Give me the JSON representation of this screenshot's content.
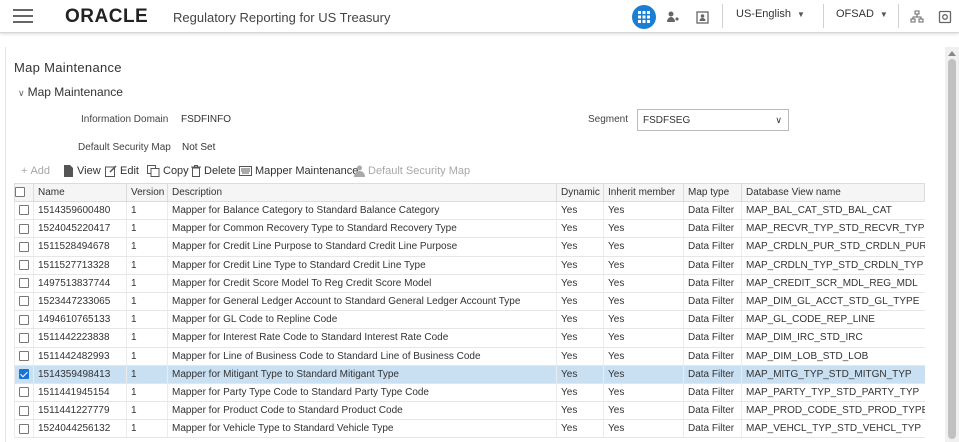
{
  "header": {
    "logo": "ORACLE",
    "app_title": "Regulatory Reporting for US Treasury",
    "language": "US-English",
    "user": "OFSAD",
    "accent_color": "#1a7fd4"
  },
  "page": {
    "title": "Map Maintenance",
    "section_title": "Map Maintenance",
    "info_domain_label": "Information Domain",
    "info_domain_value": "FSDFINFO",
    "segment_label": "Segment",
    "segment_value": "FSDFSEG",
    "default_security_map_label": "Default Security Map",
    "default_security_map_value": "Not Set"
  },
  "toolbar": {
    "add": "Add",
    "view": "View",
    "edit": "Edit",
    "copy": "Copy",
    "delete": "Delete",
    "mapper_maintenance": "Mapper Maintenance",
    "default_security_map": "Default Security Map"
  },
  "table": {
    "columns": [
      "Name",
      "Version",
      "Description",
      "Dynamic",
      "Inherit member",
      "Map type",
      "Database View name"
    ],
    "rows": [
      {
        "name": "1514359600480",
        "version": "1",
        "description": "Mapper for Balance Category to Standard Balance Category",
        "dynamic": "Yes",
        "inherit": "Yes",
        "map_type": "Data Filter",
        "view": "MAP_BAL_CAT_STD_BAL_CAT",
        "checked": false
      },
      {
        "name": "1524045220417",
        "version": "1",
        "description": "Mapper for Common Recovery Type to Standard Recovery Type",
        "dynamic": "Yes",
        "inherit": "Yes",
        "map_type": "Data Filter",
        "view": "MAP_RECVR_TYP_STD_RECVR_TYP",
        "checked": false
      },
      {
        "name": "1511528494678",
        "version": "1",
        "description": "Mapper for Credit Line Purpose to Standard Credit Line Purpose",
        "dynamic": "Yes",
        "inherit": "Yes",
        "map_type": "Data Filter",
        "view": "MAP_CRDLN_PUR_STD_CRDLN_PUR",
        "checked": false
      },
      {
        "name": "1511527713328",
        "version": "1",
        "description": "Mapper for Credit Line Type to Standard Credit Line Type",
        "dynamic": "Yes",
        "inherit": "Yes",
        "map_type": "Data Filter",
        "view": "MAP_CRDLN_TYP_STD_CRDLN_TYP",
        "checked": false
      },
      {
        "name": "1497513837744",
        "version": "1",
        "description": "Mapper for Credit Score Model To Reg Credit Score Model",
        "dynamic": "Yes",
        "inherit": "Yes",
        "map_type": "Data Filter",
        "view": "MAP_CREDIT_SCR_MDL_REG_MDL",
        "checked": false
      },
      {
        "name": "1523447233065",
        "version": "1",
        "description": "Mapper for General Ledger Account to Standard General Ledger Account Type",
        "dynamic": "Yes",
        "inherit": "Yes",
        "map_type": "Data Filter",
        "view": "MAP_DIM_GL_ACCT_STD_GL_TYPE",
        "checked": false
      },
      {
        "name": "1494610765133",
        "version": "1",
        "description": "Mapper for GL Code to Repline Code",
        "dynamic": "Yes",
        "inherit": "Yes",
        "map_type": "Data Filter",
        "view": "MAP_GL_CODE_REP_LINE",
        "checked": false
      },
      {
        "name": "1511442223838",
        "version": "1",
        "description": "Mapper for Interest Rate Code to Standard Interest Rate Code",
        "dynamic": "Yes",
        "inherit": "Yes",
        "map_type": "Data Filter",
        "view": "MAP_DIM_IRC_STD_IRC",
        "checked": false
      },
      {
        "name": "1511442482993",
        "version": "1",
        "description": "Mapper for Line of Business Code to Standard Line of Business Code",
        "dynamic": "Yes",
        "inherit": "Yes",
        "map_type": "Data Filter",
        "view": "MAP_DIM_LOB_STD_LOB",
        "checked": false
      },
      {
        "name": "1514359498413",
        "version": "1",
        "description": "Mapper for Mitigant Type to Standard Mitigant Type",
        "dynamic": "Yes",
        "inherit": "Yes",
        "map_type": "Data Filter",
        "view": "MAP_MITG_TYP_STD_MITGN_TYP",
        "checked": true
      },
      {
        "name": "1511441945154",
        "version": "1",
        "description": "Mapper for Party Type Code to Standard Party Type Code",
        "dynamic": "Yes",
        "inherit": "Yes",
        "map_type": "Data Filter",
        "view": "MAP_PARTY_TYP_STD_PARTY_TYP",
        "checked": false
      },
      {
        "name": "1511441227779",
        "version": "1",
        "description": "Mapper for Product Code to Standard Product Code",
        "dynamic": "Yes",
        "inherit": "Yes",
        "map_type": "Data Filter",
        "view": "MAP_PROD_CODE_STD_PROD_TYPE",
        "checked": false
      },
      {
        "name": "1524044256132",
        "version": "1",
        "description": "Mapper for Vehicle Type to Standard Vehicle Type",
        "dynamic": "Yes",
        "inherit": "Yes",
        "map_type": "Data Filter",
        "view": "MAP_VEHCL_TYP_STD_VEHCL_TYP",
        "checked": false
      }
    ]
  }
}
